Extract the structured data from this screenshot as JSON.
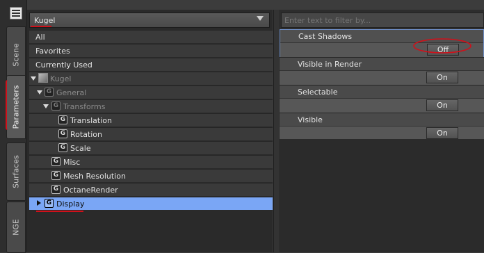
{
  "tabs": [
    {
      "label": "Scene"
    },
    {
      "label": "Parameters"
    },
    {
      "label": "Surfaces"
    },
    {
      "label": "NGE"
    }
  ],
  "dropdown": {
    "selected": "Kugel"
  },
  "categories": [
    "All",
    "Favorites",
    "Currently Used"
  ],
  "tree": {
    "root": "Kugel",
    "general": "General",
    "transforms": "Transforms",
    "translation": "Translation",
    "rotation": "Rotation",
    "scale": "Scale",
    "misc": "Misc",
    "mesh_resolution": "Mesh Resolution",
    "octane_render": "OctaneRender",
    "display": "Display",
    "group_glyph": "G"
  },
  "filter": {
    "placeholder": "Enter text to filter by..."
  },
  "properties": [
    {
      "name": "Cast Shadows",
      "value": "Off"
    },
    {
      "name": "Visible in Render",
      "value": "On"
    },
    {
      "name": "Selectable",
      "value": "On"
    },
    {
      "name": "Visible",
      "value": "On"
    }
  ],
  "colors": {
    "selection": "#7aa6f5",
    "annotation": "#d0101a",
    "focus_border": "#6f8fc8"
  }
}
